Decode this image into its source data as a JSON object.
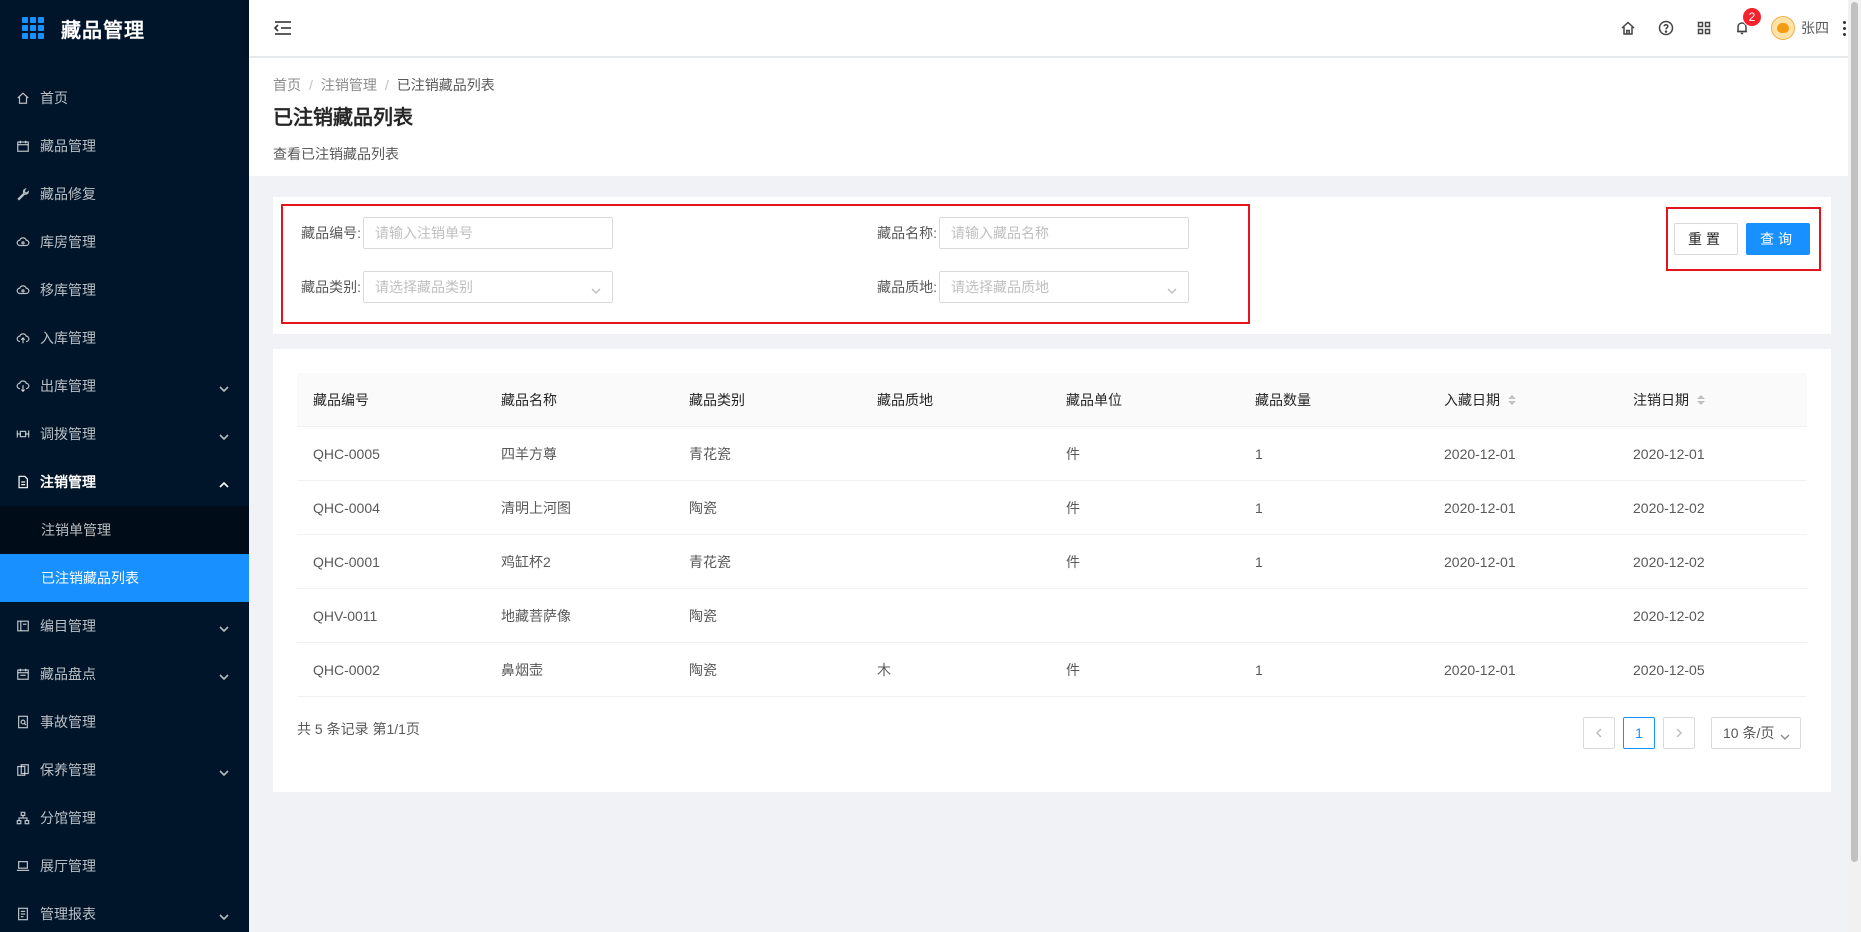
{
  "app": {
    "title": "藏品管理"
  },
  "sidebar": {
    "items": [
      {
        "label": "首页",
        "icon": "home-icon",
        "has_arrow": false
      },
      {
        "label": "藏品管理",
        "icon": "calendar-icon",
        "has_arrow": false
      },
      {
        "label": "藏品修复",
        "icon": "wrench-icon",
        "has_arrow": false
      },
      {
        "label": "库房管理",
        "icon": "cloud-icon",
        "has_arrow": false
      },
      {
        "label": "移库管理",
        "icon": "cloud-icon",
        "has_arrow": false
      },
      {
        "label": "入库管理",
        "icon": "cloud-upload-icon",
        "has_arrow": false
      },
      {
        "label": "出库管理",
        "icon": "cloud-download-icon",
        "has_arrow": true
      },
      {
        "label": "调拨管理",
        "icon": "transfer-icon",
        "has_arrow": true
      },
      {
        "label": "注销管理",
        "icon": "file-icon",
        "has_arrow": true,
        "open": true,
        "children": [
          {
            "label": "注销单管理"
          },
          {
            "label": "已注销藏品列表",
            "active": true
          }
        ]
      },
      {
        "label": "编目管理",
        "icon": "catalog-icon",
        "has_arrow": true
      },
      {
        "label": "藏品盘点",
        "icon": "inventory-icon",
        "has_arrow": true
      },
      {
        "label": "事故管理",
        "icon": "incident-icon",
        "has_arrow": false
      },
      {
        "label": "保养管理",
        "icon": "maintenance-icon",
        "has_arrow": true
      },
      {
        "label": "分馆管理",
        "icon": "branch-icon",
        "has_arrow": false
      },
      {
        "label": "展厅管理",
        "icon": "laptop-icon",
        "has_arrow": false
      },
      {
        "label": "管理报表",
        "icon": "report-icon",
        "has_arrow": true
      }
    ]
  },
  "header": {
    "notification_count": "2",
    "user_name": "张四"
  },
  "breadcrumb": [
    "首页",
    "注销管理",
    "已注销藏品列表"
  ],
  "page": {
    "title": "已注销藏品列表",
    "description": "查看已注销藏品列表"
  },
  "filters": {
    "code_label": "藏品编号:",
    "code_placeholder": "请输入注销单号",
    "name_label": "藏品名称:",
    "name_placeholder": "请输入藏品名称",
    "category_label": "藏品类别:",
    "category_placeholder": "请选择藏品类别",
    "material_label": "藏品质地:",
    "material_placeholder": "请选择藏品质地",
    "reset_label": "重置",
    "query_label": "查询"
  },
  "table": {
    "columns": [
      "藏品编号",
      "藏品名称",
      "藏品类别",
      "藏品质地",
      "藏品单位",
      "藏品数量",
      "入藏日期",
      "注销日期"
    ],
    "rows": [
      [
        "QHC-0005",
        "四羊方尊",
        "青花瓷",
        "",
        "件",
        "1",
        "2020-12-01",
        "2020-12-01"
      ],
      [
        "QHC-0004",
        "清明上河图",
        "陶瓷",
        "",
        "件",
        "1",
        "2020-12-01",
        "2020-12-02"
      ],
      [
        "QHC-0001",
        "鸡缸杯2",
        "青花瓷",
        "",
        "件",
        "1",
        "2020-12-01",
        "2020-12-02"
      ],
      [
        "QHV-0011",
        "地藏菩萨像",
        "陶瓷",
        "",
        "",
        "",
        "",
        "2020-12-02"
      ],
      [
        "QHC-0002",
        "鼻烟壶",
        "陶瓷",
        "木",
        "件",
        "1",
        "2020-12-01",
        "2020-12-05"
      ]
    ]
  },
  "pagination": {
    "total_text": "共 5 条记录 第1/1页",
    "current_page": "1",
    "page_size": "10 条/页"
  }
}
